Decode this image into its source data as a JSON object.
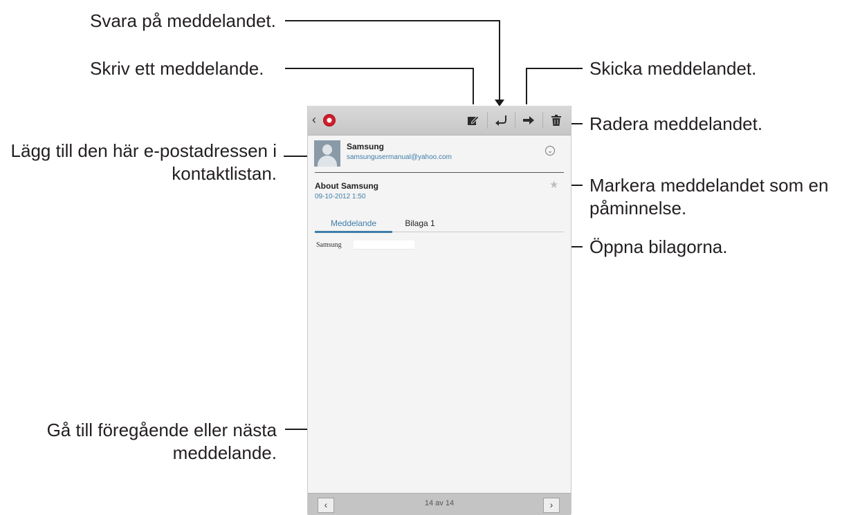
{
  "callouts": {
    "reply": "Svara på meddelandet.",
    "compose": "Skriv ett meddelande.",
    "forward": "Skicka meddelandet.",
    "delete": "Radera meddelandet.",
    "add_contact_line1": "Lägg till den här e-postadressen i",
    "add_contact_line2": "kontaktlistan.",
    "mark_line1": "Markera meddelandet som en",
    "mark_line2": "påminnelse.",
    "attachments": "Öppna bilagorna.",
    "prev_next_line1": "Gå till föregående eller nästa",
    "prev_next_line2": "meddelande."
  },
  "actionbar": {
    "back_icon": "back-chevron-icon",
    "app_icon": "email-app-icon",
    "compose_icon": "compose-icon",
    "reply_icon": "reply-icon",
    "forward_icon": "forward-arrow-icon",
    "delete_icon": "trash-icon"
  },
  "email": {
    "sender_name": "Samsung",
    "sender_email": "samsungusermanual@yahoo.com",
    "subject": "About Samsung",
    "date": "09-10-2012  1:50",
    "body": "Samsung"
  },
  "tabs": [
    {
      "label": "Meddelande",
      "selected": true
    },
    {
      "label": "Bilaga 1",
      "selected": false
    }
  ],
  "pager": {
    "counter": "14 av 14"
  },
  "colors": {
    "accent": "#3e7da8",
    "actionbar": "#cfcfcf",
    "screen_bg": "#f4f4f4"
  }
}
